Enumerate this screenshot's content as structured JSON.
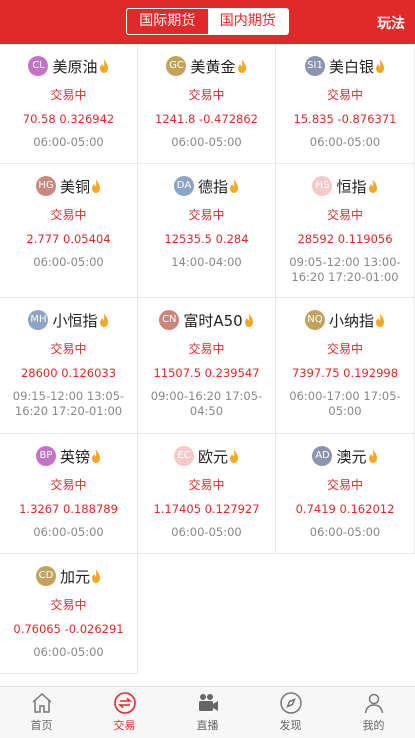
{
  "header": {
    "tabs": [
      {
        "label": "国际期货",
        "active": false
      },
      {
        "label": "国内期货",
        "active": true
      }
    ],
    "right_label": "玩法"
  },
  "items": [
    {
      "code": "CL",
      "name": "美原油",
      "status": "交易中",
      "price": "70.58",
      "change": "0.326942",
      "hours": "06:00-05:00",
      "badge_color": "#c472c8"
    },
    {
      "code": "GC",
      "name": "美黄金",
      "status": "交易中",
      "price": "1241.8",
      "change": "-0.472862",
      "hours": "06:00-05:00",
      "badge_color": "#c3a35b"
    },
    {
      "code": "SI1",
      "name": "美白银",
      "status": "交易中",
      "price": "15.835",
      "change": "-0.876371",
      "hours": "06:00-05:00",
      "badge_color": "#8b95b0"
    },
    {
      "code": "HG",
      "name": "美铜",
      "status": "交易中",
      "price": "2.777",
      "change": "0.05404",
      "hours": "06:00-05:00",
      "badge_color": "#c9887e"
    },
    {
      "code": "DA",
      "name": "德指",
      "status": "交易中",
      "price": "12535.5",
      "change": "0.284",
      "hours": "14:00-04:00",
      "badge_color": "#8ea3c8"
    },
    {
      "code": "HS",
      "name": "恒指",
      "status": "交易中",
      "price": "28592",
      "change": "0.119056",
      "hours": "09:05-12:00 13:00-16:20 17:20-01:00",
      "badge_color": "#f5c9c9"
    },
    {
      "code": "MH",
      "name": "小恒指",
      "status": "交易中",
      "price": "28600",
      "change": "0.126033",
      "hours": "09:15-12:00 13:05-16:20 17:20-01:00",
      "badge_color": "#8ea3c8"
    },
    {
      "code": "CN",
      "name": "富时A50",
      "status": "交易中",
      "price": "11507.5",
      "change": "0.239547",
      "hours": "09:00-16:20 17:05-04:50",
      "badge_color": "#c9887e"
    },
    {
      "code": "NQ",
      "name": "小纳指",
      "status": "交易中",
      "price": "7397.75",
      "change": "0.192998",
      "hours": "06:00-17:00 17:05-05:00",
      "badge_color": "#c3a35b"
    },
    {
      "code": "BP",
      "name": "英镑",
      "status": "交易中",
      "price": "1.3267",
      "change": "0.188789",
      "hours": "06:00-05:00",
      "badge_color": "#c472c8"
    },
    {
      "code": "EC",
      "name": "欧元",
      "status": "交易中",
      "price": "1.17405",
      "change": "0.127927",
      "hours": "06:00-05:00",
      "badge_color": "#f5c9c9"
    },
    {
      "code": "AD",
      "name": "澳元",
      "status": "交易中",
      "price": "0.7419",
      "change": "0.162012",
      "hours": "06:00-05:00",
      "badge_color": "#8b95b0"
    },
    {
      "code": "CD",
      "name": "加元",
      "status": "交易中",
      "price": "0.76065",
      "change": "-0.026291",
      "hours": "06:00-05:00",
      "badge_color": "#c3a35b"
    }
  ],
  "tabbar": [
    {
      "label": "首页",
      "icon": "home-icon",
      "active": false
    },
    {
      "label": "交易",
      "icon": "trade-icon",
      "active": true
    },
    {
      "label": "直播",
      "icon": "video-camera-icon",
      "active": false
    },
    {
      "label": "发现",
      "icon": "compass-icon",
      "active": false
    },
    {
      "label": "我的",
      "icon": "user-icon",
      "active": false
    }
  ],
  "colors": {
    "accent": "#e02a2a",
    "muted": "#888888",
    "fire": "#f5a623"
  }
}
